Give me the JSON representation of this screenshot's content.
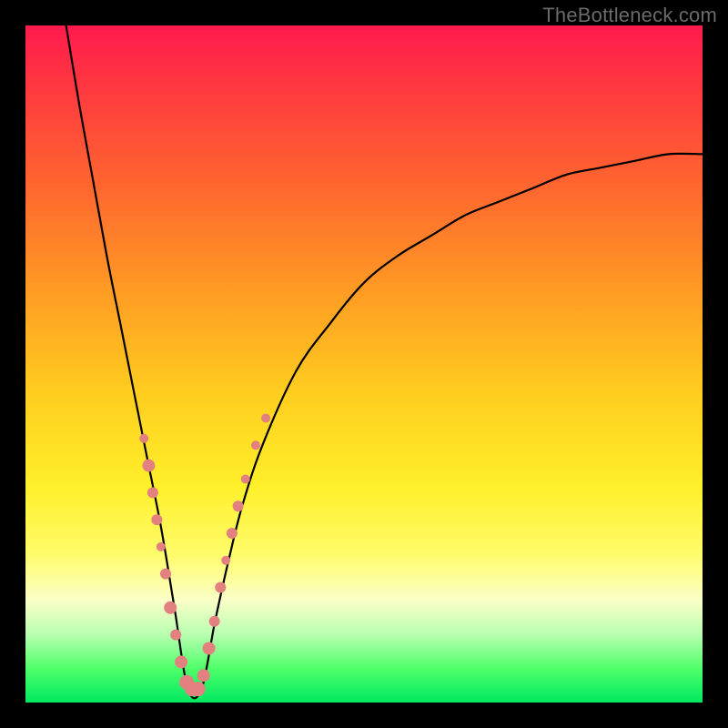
{
  "watermark": "TheBottleneck.com",
  "colors": {
    "frame": "#000000",
    "curve": "#000000",
    "marker_fill": "#e38080",
    "marker_stroke": "#d86f6f"
  },
  "chart_data": {
    "type": "line",
    "title": "",
    "xlabel": "",
    "ylabel": "",
    "xlim": [
      0,
      100
    ],
    "ylim": [
      0,
      100
    ],
    "notes": "V-shaped bottleneck curve. Y-axis is bottleneck percentage (0 at bottom / green, 100 at top / red). Background color encodes y-value. Curve moves from top-left steeply down to a trough near x≈24, y≈0, then rises with decreasing slope toward upper-right (~x=100, y≈81). Pink markers cluster along the lower arms of the V near the trough.",
    "series": [
      {
        "name": "bottleneck-curve",
        "x": [
          6,
          8,
          10,
          12,
          14,
          16,
          18,
          20,
          22,
          24,
          26,
          28,
          30,
          32,
          35,
          40,
          45,
          50,
          55,
          60,
          65,
          70,
          75,
          80,
          85,
          90,
          95,
          100
        ],
        "y": [
          100,
          88,
          77,
          66,
          56,
          46,
          36,
          26,
          14,
          2,
          2,
          12,
          21,
          29,
          38,
          49,
          56,
          62,
          66,
          69,
          72,
          74,
          76,
          78,
          79,
          80,
          81,
          81
        ]
      }
    ],
    "markers": [
      {
        "x": 17.5,
        "y": 39,
        "r": 5
      },
      {
        "x": 18.2,
        "y": 35,
        "r": 7
      },
      {
        "x": 18.8,
        "y": 31,
        "r": 6
      },
      {
        "x": 19.4,
        "y": 27,
        "r": 6
      },
      {
        "x": 20.0,
        "y": 23,
        "r": 5
      },
      {
        "x": 20.7,
        "y": 19,
        "r": 6
      },
      {
        "x": 21.4,
        "y": 14,
        "r": 7
      },
      {
        "x": 22.2,
        "y": 10,
        "r": 6
      },
      {
        "x": 23.0,
        "y": 6,
        "r": 7
      },
      {
        "x": 23.8,
        "y": 3,
        "r": 8
      },
      {
        "x": 24.6,
        "y": 2,
        "r": 8
      },
      {
        "x": 25.5,
        "y": 2,
        "r": 8
      },
      {
        "x": 26.3,
        "y": 4,
        "r": 7
      },
      {
        "x": 27.1,
        "y": 8,
        "r": 7
      },
      {
        "x": 27.9,
        "y": 12,
        "r": 6
      },
      {
        "x": 28.8,
        "y": 17,
        "r": 6
      },
      {
        "x": 29.6,
        "y": 21,
        "r": 5
      },
      {
        "x": 30.5,
        "y": 25,
        "r": 6
      },
      {
        "x": 31.4,
        "y": 29,
        "r": 6
      },
      {
        "x": 32.5,
        "y": 33,
        "r": 5
      },
      {
        "x": 34.0,
        "y": 38,
        "r": 5
      },
      {
        "x": 35.5,
        "y": 42,
        "r": 5
      }
    ]
  }
}
